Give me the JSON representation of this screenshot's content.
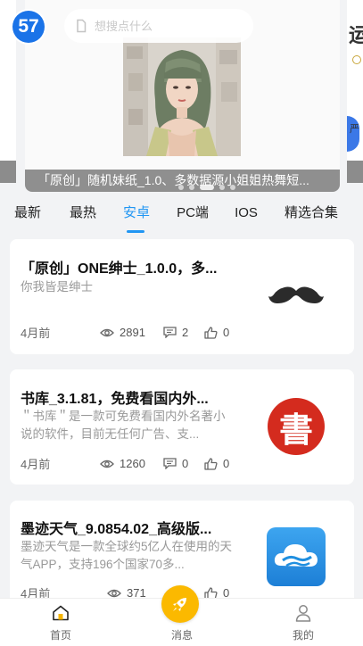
{
  "header": {
    "logo_text": "57",
    "search_placeholder": "想搜点什么"
  },
  "banner": {
    "caption": "「原创」随机妹纸_1.0、多数据源小姐姐热舞短...",
    "side_glyph": "运",
    "side_tiny": "严",
    "dot_count": 5,
    "active_dot": 2
  },
  "tabs": [
    {
      "label": "最新"
    },
    {
      "label": "最热"
    },
    {
      "label": "安卓"
    },
    {
      "label": "PC端"
    },
    {
      "label": "IOS"
    },
    {
      "label": "精选合集"
    }
  ],
  "active_tab": 2,
  "cards": [
    {
      "title": "「原创」ONE绅士_1.0.0，多...",
      "desc": "你我皆是绅士",
      "time": "4月前",
      "views": "2891",
      "comments": "2",
      "likes": "0",
      "icon": "mustache-icon"
    },
    {
      "title": "书库_3.1.81，免费看国内外...",
      "desc": "＂书库＂是一款可免费看国内外名著小说的软件，目前无任何广告、支...",
      "time": "4月前",
      "views": "1260",
      "comments": "0",
      "likes": "0",
      "icon": "shu-book-icon",
      "icon_char": "書"
    },
    {
      "title": "墨迹天气_9.0854.02_高级版...",
      "desc": "墨迹天气是一款全球约5亿人在使用的天气APP，支持196个国家70多...",
      "time": "4月前",
      "views": "371",
      "comments": "0",
      "likes": "0",
      "icon": "weather-cloud-icon"
    }
  ],
  "bottom_nav": {
    "home": "首页",
    "messages": "消息",
    "mine": "我的"
  },
  "colors": {
    "accent": "#2196f3",
    "logo": "#1a73e8",
    "center_button": "#fbb900",
    "home_icon": "#f5b400",
    "book_red": "#d42b1e",
    "weather_blue": "#1f8fe0"
  }
}
